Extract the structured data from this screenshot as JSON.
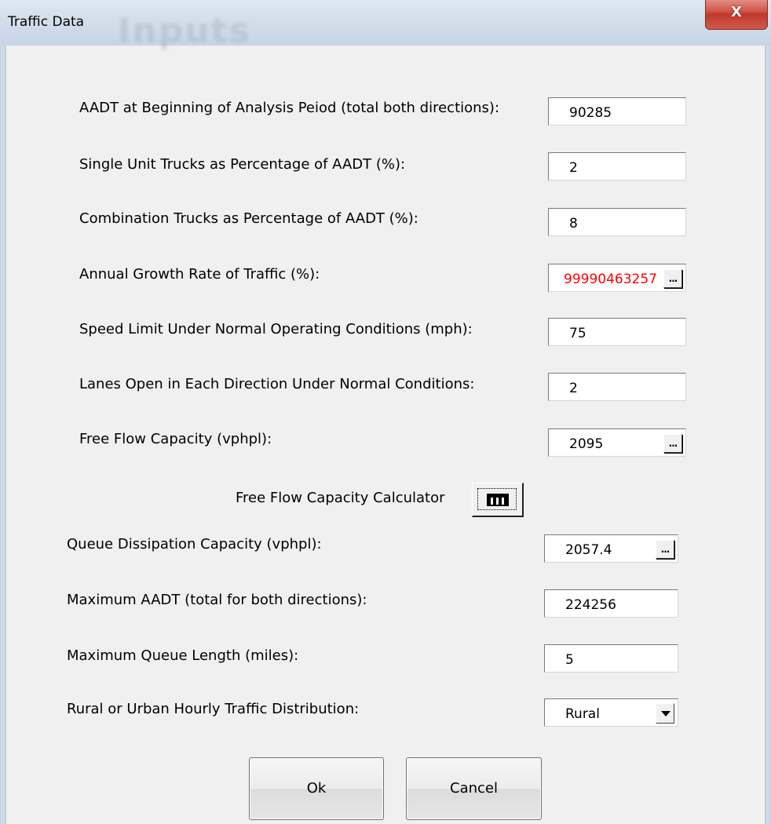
{
  "window": {
    "title": "Traffic Data",
    "background_ghost_title": "Inputs",
    "close_label": "X"
  },
  "fields": [
    {
      "label": "AADT at Beginning of Analysis Peiod (total both directions):",
      "value": "90285"
    },
    {
      "label": "Single Unit Trucks as Percentage of AADT (%):",
      "value": "2"
    },
    {
      "label": "Combination Trucks as Percentage of AADT (%):",
      "value": "8"
    },
    {
      "label": "Annual Growth Rate of Traffic (%):",
      "value": "99990463257",
      "value_color": "#ff0000",
      "has_ellipsis": true
    },
    {
      "label": "Speed Limit Under Normal Operating Conditions (mph):",
      "value": "75"
    },
    {
      "label": "Lanes Open in Each Direction Under Normal Conditions:",
      "value": "2"
    },
    {
      "label": "Free Flow Capacity (vphpl):",
      "value": "2095",
      "has_ellipsis": true
    },
    {
      "label": "Queue Dissipation Capacity (vphpl):",
      "value": "2057.4",
      "has_ellipsis": true
    },
    {
      "label": "Maximum AADT (total for both directions):",
      "value": "224256"
    },
    {
      "label": "Maximum Queue Length (miles):",
      "value": "5"
    }
  ],
  "calculator": {
    "label": "Free Flow Capacity Calculator",
    "icon": "calculator-icon"
  },
  "distribution": {
    "label": "Rural or Urban Hourly Traffic Distribution:",
    "selected": "Rural"
  },
  "buttons": {
    "ellipsis_label": "...",
    "ok_label": "Ok",
    "cancel_label": "Cancel"
  }
}
